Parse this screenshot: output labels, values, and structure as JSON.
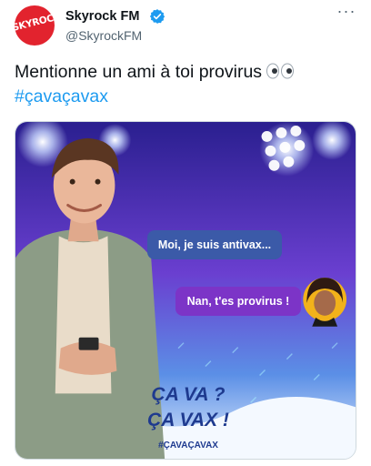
{
  "tweet": {
    "author_name": "Skyrock FM",
    "author_handle": "@SkyrockFM",
    "avatar_logo_text": "SKYROCK",
    "text": "Mentionne un ami à toi provirus",
    "emoji": "eyes",
    "hashtag": "#çavaçavax"
  },
  "image": {
    "bubble_1": "Moi, je suis antivax...",
    "bubble_2": "Nan, t'es provirus !",
    "slogan_line_1": "ÇA VA ?",
    "slogan_line_2": "ÇA VAX !",
    "image_hashtag": "#ÇAVAÇAVAX"
  },
  "icons": {
    "verified": "verified-badge-icon",
    "more": "more-options-icon"
  },
  "colors": {
    "accent": "#1d9bf0",
    "brand_red": "#e2232e",
    "bubble_blue": "#3b5aa8",
    "bubble_purple": "#7c34c7",
    "slogan_blue": "#1e3a8f"
  }
}
